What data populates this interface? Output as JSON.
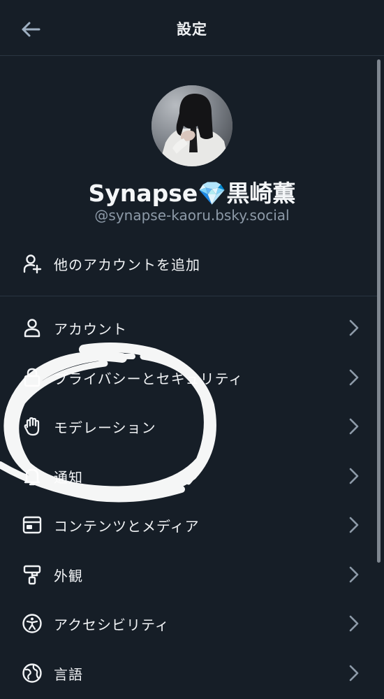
{
  "header": {
    "title": "設定"
  },
  "profile": {
    "display_name": "Synapse💎黒崎薫",
    "handle": "@synapse-kaoru.bsky.social"
  },
  "add_account": {
    "label": "他のアカウントを追加",
    "icon": "person-add-icon"
  },
  "menu": {
    "items": [
      {
        "label": "アカウント",
        "icon": "person-icon"
      },
      {
        "label": "プライバシーとセキュリティ",
        "icon": "lock-icon"
      },
      {
        "label": "モデレーション",
        "icon": "hand-icon"
      },
      {
        "label": "通知",
        "icon": "bell-icon"
      },
      {
        "label": "コンテンツとメディア",
        "icon": "window-icon"
      },
      {
        "label": "外観",
        "icon": "paint-roller-icon"
      },
      {
        "label": "アクセシビリティ",
        "icon": "accessibility-icon"
      },
      {
        "label": "言語",
        "icon": "globe-icon"
      }
    ]
  },
  "colors": {
    "background": "#161e27",
    "text": "#f1f3f5",
    "muted": "#8d9aa8",
    "chevron": "#8d9aa8",
    "divider": "#2a3541",
    "scribble": "#ffffff"
  }
}
